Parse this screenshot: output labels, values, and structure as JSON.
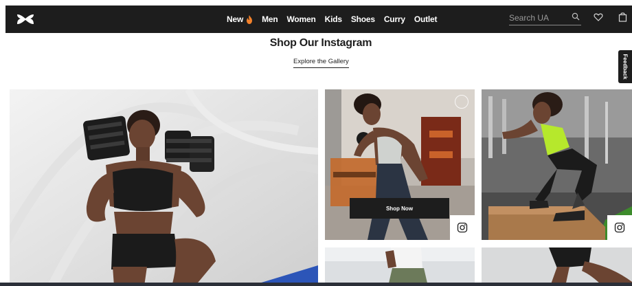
{
  "header": {
    "brand": "Under Armour",
    "nav_items": [
      {
        "label": "New",
        "icon": "flame-icon"
      },
      {
        "label": "Men"
      },
      {
        "label": "Women"
      },
      {
        "label": "Kids"
      },
      {
        "label": "Shoes"
      },
      {
        "label": "Curry"
      },
      {
        "label": "Outlet"
      }
    ],
    "search": {
      "placeholder": "Search UA"
    },
    "icons": [
      "search-icon",
      "heart-icon",
      "bag-icon"
    ]
  },
  "instagram": {
    "title": "Shop Our Instagram",
    "explore_label": "Explore the Gallery",
    "shop_now_label": "Shop Now"
  },
  "feedback_label": "Feedback",
  "colors": {
    "header_bg": "#1d1d1d",
    "flame": "#f2812b",
    "accent_green": "#b6e82c",
    "text": "#1d1d1d"
  }
}
